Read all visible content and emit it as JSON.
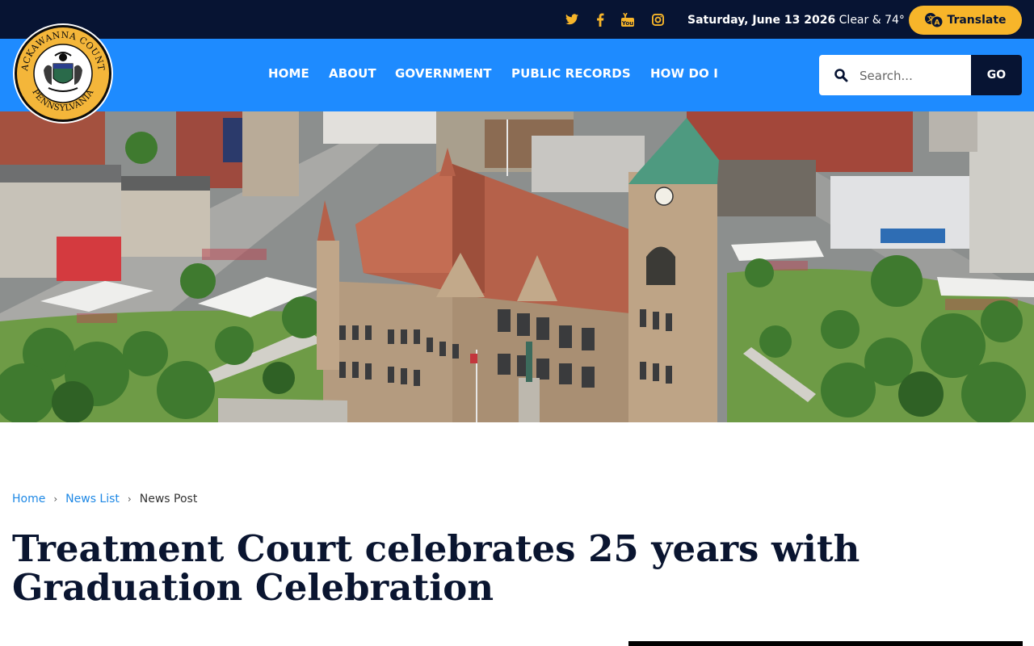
{
  "topbar": {
    "social": [
      {
        "icon": "twitter-icon",
        "name": "Twitter"
      },
      {
        "icon": "facebook-icon",
        "name": "Facebook"
      },
      {
        "icon": "youtube-icon",
        "name": "YouTube"
      },
      {
        "icon": "instagram-icon",
        "name": "Instagram"
      }
    ],
    "date": "Saturday, June 13 2026",
    "weather": "Clear & 74°",
    "translate_label": "Translate",
    "colors": {
      "background": "#071433",
      "accent": "#f7b52a"
    }
  },
  "header": {
    "seal": {
      "top_text": "LACKAWANNA COUNTY",
      "bottom_text": "PENNSYLVANIA"
    },
    "nav": [
      {
        "label": "HOME"
      },
      {
        "label": "ABOUT"
      },
      {
        "label": "GOVERNMENT"
      },
      {
        "label": "PUBLIC RECORDS"
      },
      {
        "label": "HOW DO I"
      }
    ],
    "search": {
      "placeholder": "Search...",
      "button_label": "GO"
    },
    "colors": {
      "background": "#1e8bff"
    }
  },
  "hero": {
    "image": "aerial-courthouse-photo"
  },
  "breadcrumb": {
    "items": [
      {
        "label": "Home"
      },
      {
        "label": "News List"
      }
    ],
    "current": "News Post"
  },
  "article": {
    "title": "Treatment Court celebrates 25 years with Graduation Celebration"
  }
}
